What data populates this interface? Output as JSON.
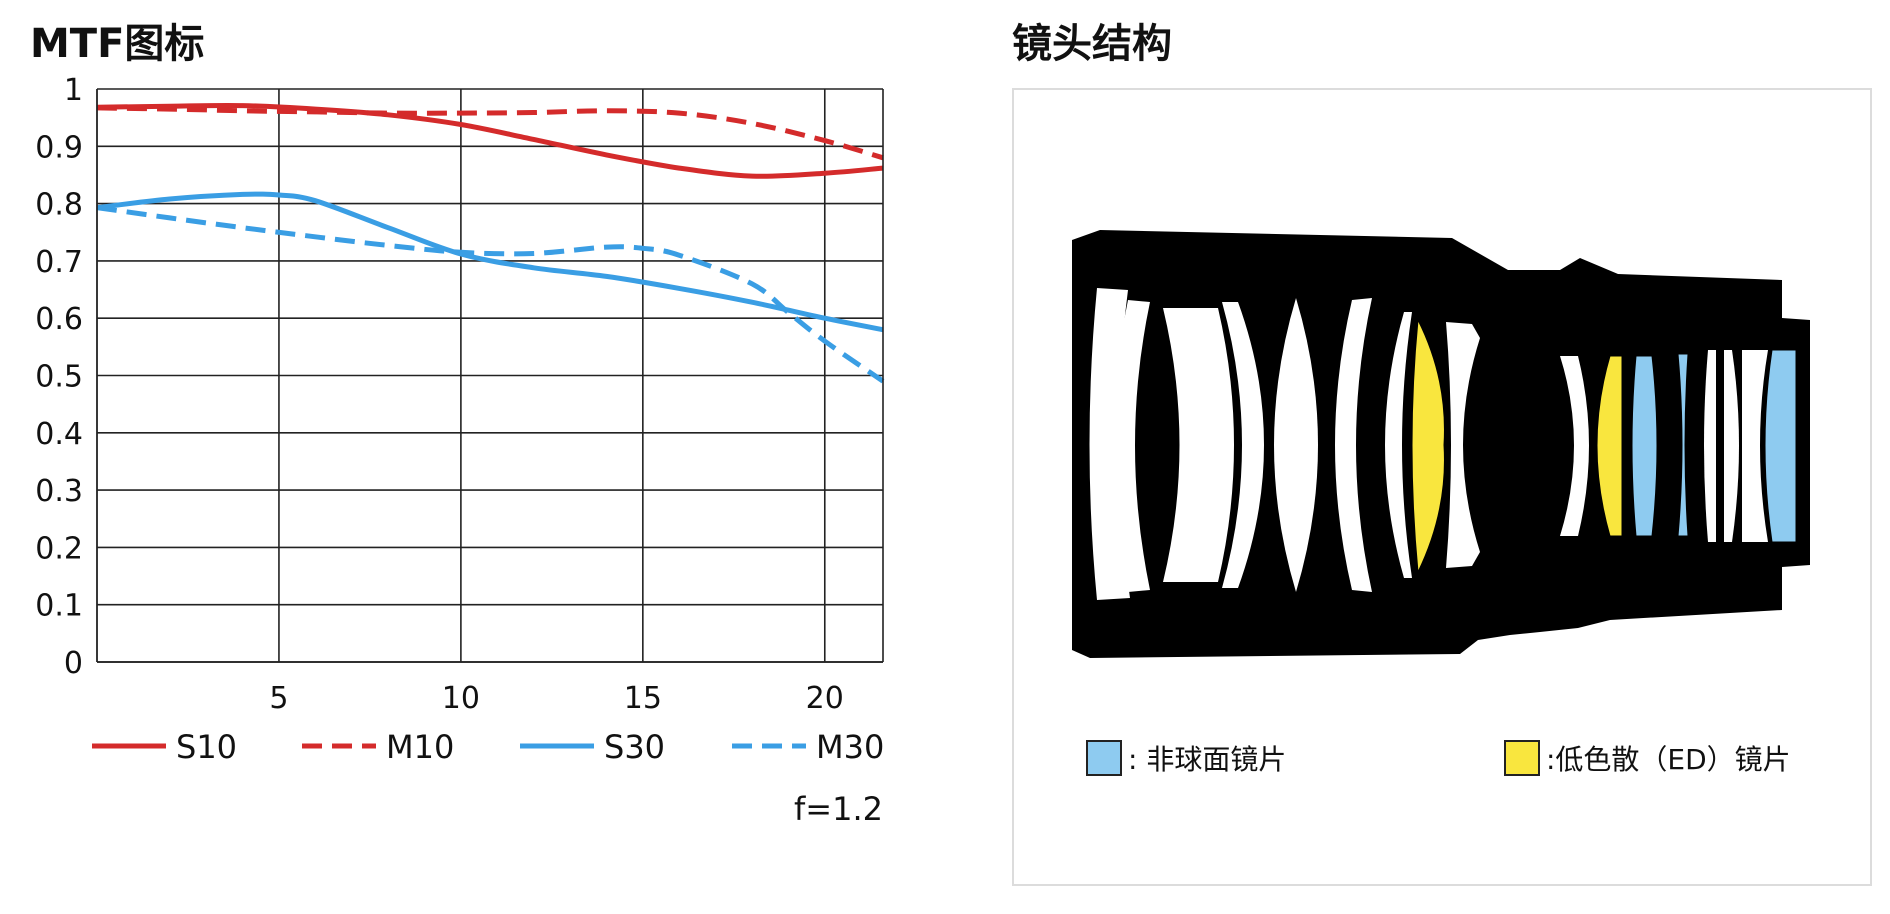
{
  "mtf_title": "MTF图标",
  "lens_title": "镜头结构",
  "chart_data": {
    "type": "line",
    "xlim": [
      0,
      21.6
    ],
    "ylim": [
      0,
      1
    ],
    "x_ticks": [
      "5",
      "10",
      "15",
      "20"
    ],
    "y_ticks": [
      "0",
      "0.1",
      "0.2",
      "0.3",
      "0.4",
      "0.5",
      "0.6",
      "0.7",
      "0.8",
      "0.9",
      "1"
    ],
    "grid": true,
    "legend_position": "bottom",
    "annotation": "f=1.2",
    "series": [
      {
        "name": "S10",
        "color": "#d42b2b",
        "dash": false,
        "x": [
          0,
          2,
          4,
          6,
          8,
          10,
          12,
          14,
          16,
          18,
          20,
          21.6
        ],
        "y": [
          0.968,
          0.97,
          0.971,
          0.965,
          0.955,
          0.938,
          0.912,
          0.885,
          0.862,
          0.848,
          0.853,
          0.862
        ]
      },
      {
        "name": "M10",
        "color": "#d42b2b",
        "dash": true,
        "x": [
          0,
          2,
          4,
          6,
          8,
          10,
          12,
          14,
          16,
          18,
          20,
          21.6
        ],
        "y": [
          0.967,
          0.965,
          0.962,
          0.96,
          0.958,
          0.958,
          0.959,
          0.962,
          0.958,
          0.94,
          0.91,
          0.88
        ]
      },
      {
        "name": "S30",
        "color": "#3a9ee4",
        "dash": false,
        "x": [
          0,
          2,
          4,
          5,
          6,
          8,
          10,
          12,
          14,
          16,
          18,
          20,
          21.6
        ],
        "y": [
          0.793,
          0.808,
          0.816,
          0.815,
          0.805,
          0.758,
          0.712,
          0.688,
          0.673,
          0.652,
          0.628,
          0.6,
          0.58
        ]
      },
      {
        "name": "M30",
        "color": "#3a9ee4",
        "dash": true,
        "x": [
          0,
          2,
          4,
          6,
          8,
          10,
          12,
          14,
          15,
          16,
          18,
          19,
          20,
          21.6
        ],
        "y": [
          0.793,
          0.775,
          0.758,
          0.742,
          0.727,
          0.715,
          0.713,
          0.724,
          0.722,
          0.71,
          0.66,
          0.61,
          0.56,
          0.49
        ]
      }
    ]
  },
  "lens_legend": [
    {
      "label": ": 非球面镜片",
      "color": "#8ecbf0"
    },
    {
      "label": ":低色散（ED）镜片",
      "color": "#f9e63e"
    }
  ]
}
